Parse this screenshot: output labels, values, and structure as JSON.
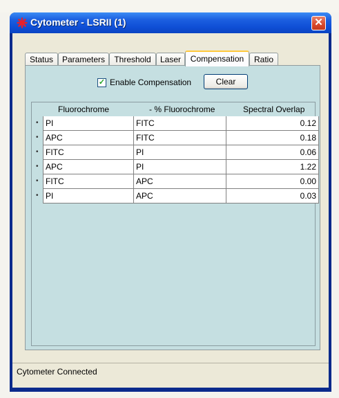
{
  "window": {
    "title": "Cytometer - LSRII (1)",
    "close_glyph": "✕",
    "icon": "red-asterisk-icon",
    "title_color": "#1c5fe0"
  },
  "tabs": [
    {
      "label": "Status",
      "active": false
    },
    {
      "label": "Parameters",
      "active": false
    },
    {
      "label": "Threshold",
      "active": false
    },
    {
      "label": "Laser",
      "active": false
    },
    {
      "label": "Compensation",
      "active": true
    },
    {
      "label": "Ratio",
      "active": false
    }
  ],
  "compensation": {
    "enable_label": "Enable Compensation",
    "enable_checked": true,
    "check_glyph": "✓",
    "clear_label": "Clear",
    "columns": [
      "Fluorochrome",
      "- % Fluorochrome",
      "Spectral Overlap"
    ],
    "row_marker": "•",
    "rows": [
      {
        "fluorochrome": "PI",
        "minus_fluorochrome": "FITC",
        "overlap": "0.12"
      },
      {
        "fluorochrome": "APC",
        "minus_fluorochrome": "FITC",
        "overlap": "0.18"
      },
      {
        "fluorochrome": "FITC",
        "minus_fluorochrome": "PI",
        "overlap": "0.06"
      },
      {
        "fluorochrome": "APC",
        "minus_fluorochrome": "PI",
        "overlap": "1.22"
      },
      {
        "fluorochrome": "FITC",
        "minus_fluorochrome": "APC",
        "overlap": "0.00"
      },
      {
        "fluorochrome": "PI",
        "minus_fluorochrome": "APC",
        "overlap": "0.03"
      }
    ]
  },
  "status": {
    "text": "Cytometer Connected"
  }
}
